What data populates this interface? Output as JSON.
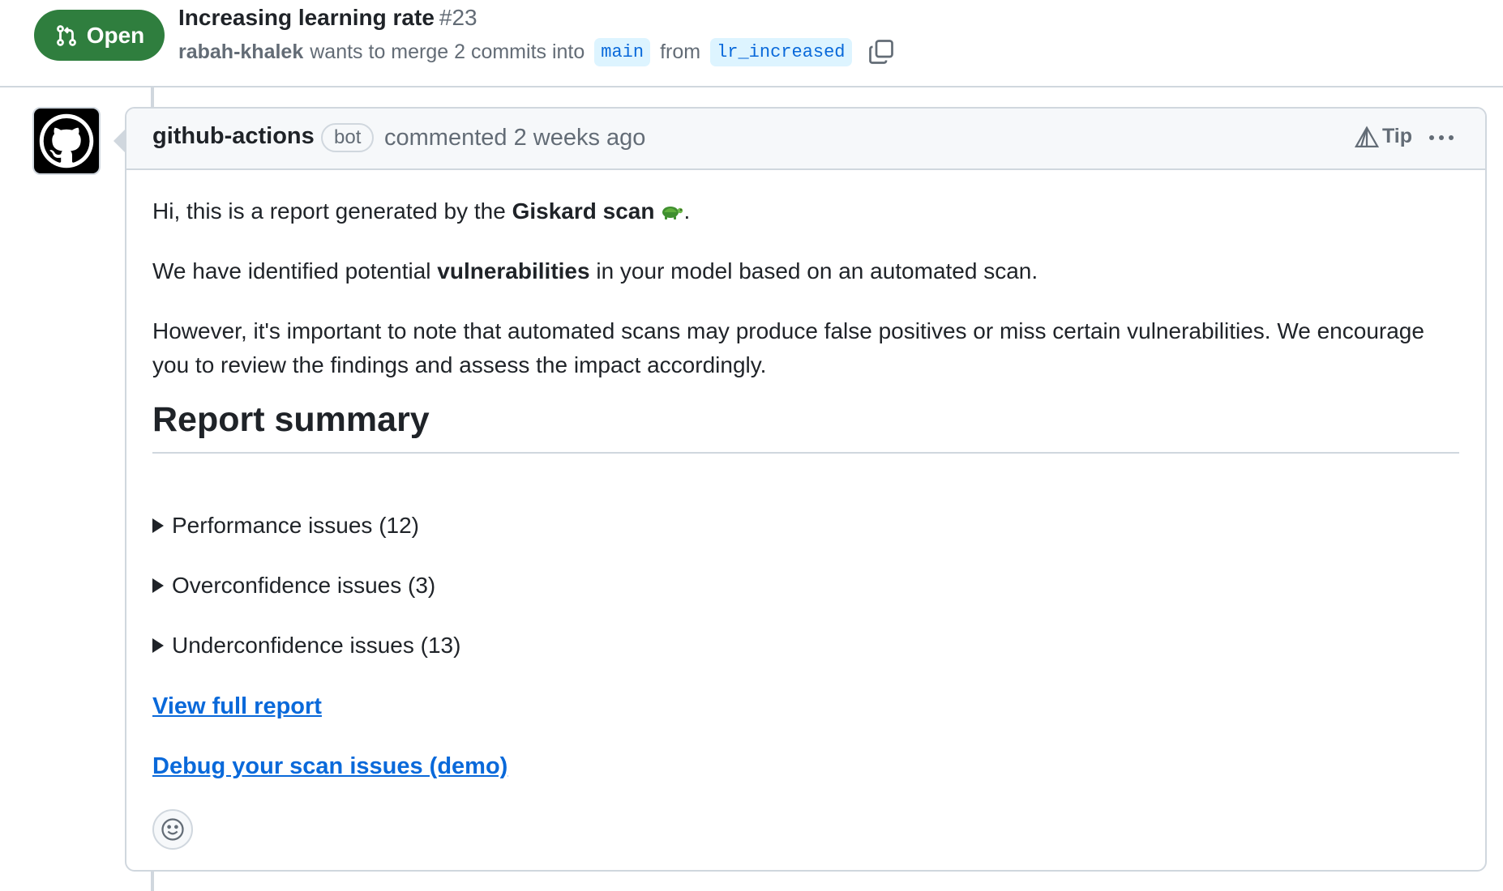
{
  "pr": {
    "state": "Open",
    "title": "Increasing learning rate",
    "number": "#23",
    "author": "rabah-khalek",
    "merge_text": "wants to merge 2 commits into",
    "base_branch": "main",
    "from_text": "from",
    "head_branch": "lr_increased"
  },
  "comment": {
    "author": "github-actions",
    "bot_label": "bot",
    "time": "commented 2 weeks ago",
    "tip_label": "Tip",
    "intro_prefix": "Hi, this is a report generated by the ",
    "intro_bold": "Giskard scan",
    "intro_suffix": ".",
    "p2_prefix": "We have identified potential ",
    "p2_bold": "vulnerabilities",
    "p2_suffix": " in your model based on an automated scan.",
    "p3": "However, it's important to note that automated scans may produce false positives or miss certain vulnerabilities. We encourage you to review the findings and assess the impact accordingly.",
    "section_title": "Report summary",
    "details": [
      {
        "label": "Performance issues (12)"
      },
      {
        "label": "Overconfidence issues (3)"
      },
      {
        "label": "Underconfidence issues (13)"
      }
    ],
    "links": [
      {
        "label": "View full report"
      },
      {
        "label": "Debug your scan issues (demo)"
      }
    ]
  },
  "colors": {
    "open_green": "#2f7e3e",
    "link_blue": "#0969da",
    "muted": "#636c76",
    "border": "#d0d7de"
  },
  "icons": [
    "git-pull-request-icon",
    "copy-icon",
    "github-logo-icon",
    "alert-triangle-icon",
    "kebab-menu-icon",
    "turtle-emoji-icon",
    "smiley-icon",
    "triangle-right-icon"
  ]
}
